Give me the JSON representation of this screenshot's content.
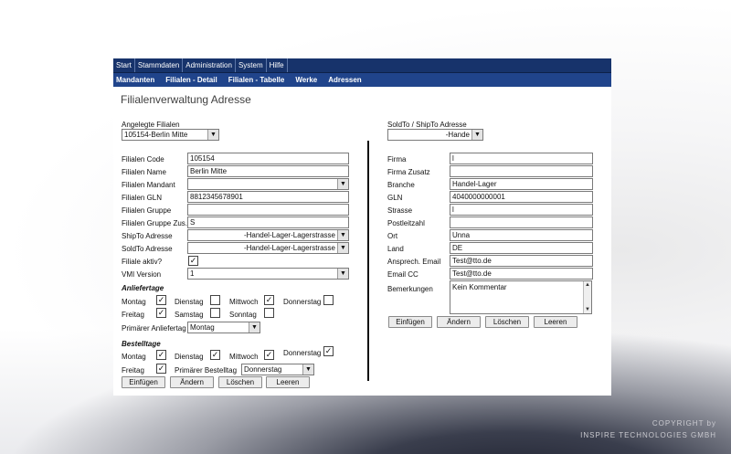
{
  "menu": {
    "items": [
      "Start",
      "Stammdaten",
      "Administration",
      "System",
      "Hilfe"
    ]
  },
  "nav": {
    "items": [
      "Mandanten",
      "Filialen - Detail",
      "Filialen - Tabelle",
      "Werke",
      "Adressen"
    ]
  },
  "page": {
    "title": "Filialenverwaltung Adresse"
  },
  "left": {
    "angelegte_label": "Angelegte Filialen",
    "angelegte_value": "105154-Berlin Mitte",
    "fields": {
      "code": {
        "label": "Filialen Code",
        "value": "105154"
      },
      "name": {
        "label": "Filialen Name",
        "value": "Berlin Mitte"
      },
      "mandant": {
        "label": "Filialen Mandant",
        "value": ""
      },
      "gln": {
        "label": "Filialen GLN",
        "value": "8812345678901"
      },
      "gruppe": {
        "label": "Filialen Gruppe",
        "value": ""
      },
      "gruppe_zus": {
        "label": "Filialen Gruppe Zus.",
        "value": "S"
      },
      "shipto": {
        "label": "ShipTo Adresse",
        "value": "-Handel-Lager-Lagerstrasse"
      },
      "soldto": {
        "label": "SoldTo Adresse",
        "value": "-Handel-Lager-Lagerstrasse"
      },
      "aktiv": {
        "label": "Filiale aktiv?",
        "checked": true
      },
      "vmi": {
        "label": "VMI Version",
        "value": "1"
      }
    },
    "anliefertage": {
      "title": "Anliefertage",
      "days": [
        {
          "label": "Montag",
          "checked": true
        },
        {
          "label": "Dienstag",
          "checked": false
        },
        {
          "label": "Mittwoch",
          "checked": true
        },
        {
          "label": "Donnerstag",
          "checked": false
        },
        {
          "label": "Freitag",
          "checked": true
        },
        {
          "label": "Samstag",
          "checked": false
        },
        {
          "label": "Sonntag",
          "checked": false
        }
      ],
      "primary_label": "Primärer Anliefertag",
      "primary_value": "Montag"
    },
    "bestelltage": {
      "title": "Bestelltage",
      "days": [
        {
          "label": "Montag",
          "checked": true
        },
        {
          "label": "Dienstag",
          "checked": true
        },
        {
          "label": "Mittwoch",
          "checked": true
        },
        {
          "label": "Donnerstag",
          "checked": true
        },
        {
          "label": "Freitag",
          "checked": true
        }
      ],
      "primary_label": "Primärer Bestelltag",
      "primary_value": "Donnerstag"
    },
    "buttons": [
      "Einfügen",
      "Ändern",
      "Löschen",
      "Leeren"
    ]
  },
  "right": {
    "soldto_label": "SoldTo / ShipTo Adresse",
    "soldto_value": "-Hande",
    "fields": {
      "firma": {
        "label": "Firma",
        "value": "l"
      },
      "firma_zusatz": {
        "label": "Firma Zusatz",
        "value": ""
      },
      "branche": {
        "label": "Branche",
        "value": "Handel-Lager"
      },
      "gln": {
        "label": "GLN",
        "value": "4040000000001"
      },
      "strasse": {
        "label": "Strasse",
        "value": "l"
      },
      "plz": {
        "label": "Postleitzahl",
        "value": ""
      },
      "ort": {
        "label": "Ort",
        "value": "Unna"
      },
      "land": {
        "label": "Land",
        "value": "DE"
      },
      "email": {
        "label": "Ansprech. Email",
        "value": "Test@tto.de"
      },
      "email_cc": {
        "label": "Email CC",
        "value": "Test@tto.de"
      },
      "bemerkungen": {
        "label": "Bemerkungen",
        "value": "Kein Kommentar"
      }
    },
    "buttons": [
      "Einfügen",
      "Ändern",
      "Löschen",
      "Leeren"
    ]
  },
  "copyright": {
    "line1": "COPYRIGHT by",
    "line2": "INSPIRE TECHNOLOGIES GMBH"
  }
}
